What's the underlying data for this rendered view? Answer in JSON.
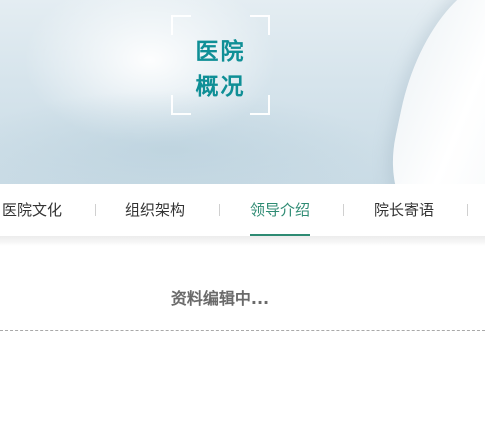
{
  "banner": {
    "title_line1": "医院",
    "title_line2": "概况",
    "title_color": "#0f8f96"
  },
  "tabs": [
    {
      "label": "医院文化",
      "active": false
    },
    {
      "label": "组织架构",
      "active": false
    },
    {
      "label": "领导介绍",
      "active": true
    },
    {
      "label": "院长寄语",
      "active": false
    }
  ],
  "accent_color": "#2e8b73",
  "content": {
    "message": "资料编辑中..."
  }
}
